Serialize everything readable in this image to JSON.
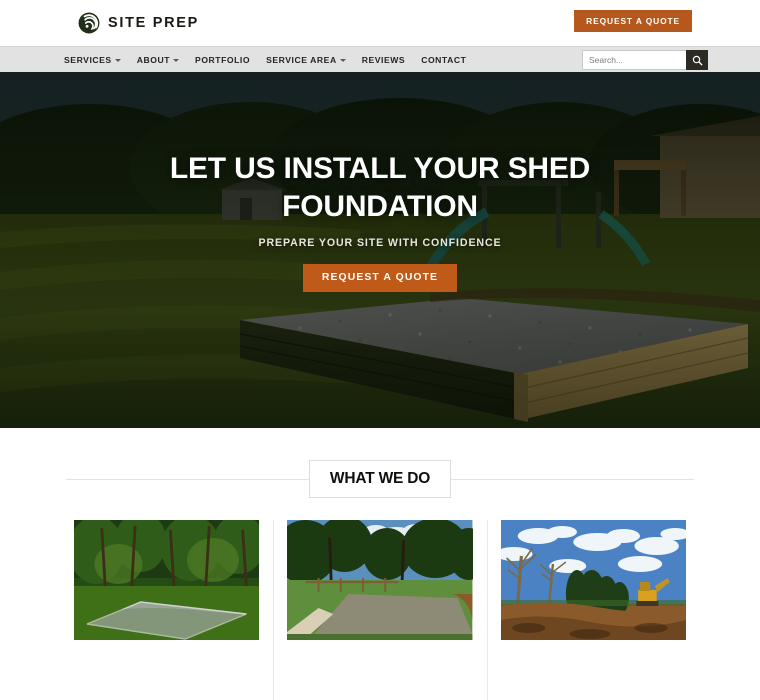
{
  "brand": {
    "name": "SITE PREP",
    "logo_icon": "spiral-arcs-logo-icon"
  },
  "header": {
    "quote_button_label": "REQUEST A QUOTE",
    "quote_button_color": "#b5581d"
  },
  "nav": {
    "items": [
      {
        "label": "SERVICES",
        "has_dropdown": true
      },
      {
        "label": "ABOUT",
        "has_dropdown": true
      },
      {
        "label": "PORTFOLIO",
        "has_dropdown": false
      },
      {
        "label": "SERVICE AREA",
        "has_dropdown": true
      },
      {
        "label": "REVIEWS",
        "has_dropdown": false
      },
      {
        "label": "CONTACT",
        "has_dropdown": false
      }
    ],
    "background_color": "#e2e2e2"
  },
  "search": {
    "placeholder": "Search...",
    "value": "",
    "button_icon": "search-icon",
    "button_color": "#2b2b24"
  },
  "hero": {
    "title_line1": "LET US INSTALL YOUR SHED",
    "title_line2": "FOUNDATION",
    "subtitle": "PREPARE YOUR SITE WITH CONFIDENCE",
    "cta_label": "REQUEST A QUOTE",
    "cta_color": "#c05a18",
    "image_description": "Backyard lawn with a gravel shed foundation framed in timber"
  },
  "what_we_do": {
    "heading": "WHAT WE DO",
    "cards": [
      {
        "image_description": "Gravel shed pad in a wooded backyard clearing"
      },
      {
        "image_description": "Large level stone pad prepared in an open yard"
      },
      {
        "image_description": "Land clearing with excavator under a blue sky"
      }
    ]
  }
}
